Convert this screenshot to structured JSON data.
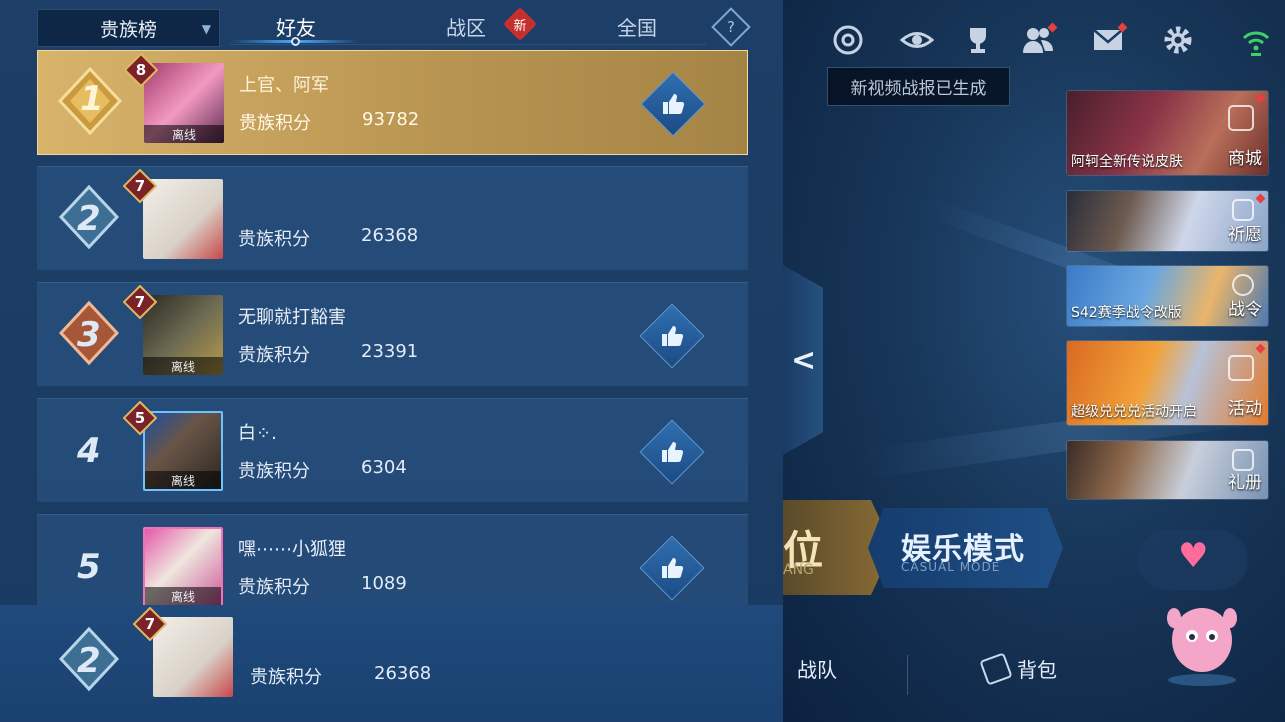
{
  "tabs": {
    "dropdown_label": "贵族榜",
    "friends": "好友",
    "zone": "战区",
    "zone_badge": "新",
    "national": "全国",
    "help": "?"
  },
  "score_label": "贵族积分",
  "offline_label": "离线",
  "rows": [
    {
      "rank": "1",
      "level": "8",
      "name": "上官、阿军",
      "score": "93782",
      "offline": true
    },
    {
      "rank": "2",
      "level": "7",
      "name": "",
      "score": "26368",
      "offline": false
    },
    {
      "rank": "3",
      "level": "7",
      "name": "无聊就打豁害",
      "score": "23391",
      "offline": true
    },
    {
      "rank": "4",
      "level": "5",
      "name": "白⁘.",
      "score": "6304",
      "offline": true
    },
    {
      "rank": "5",
      "level": "",
      "name": "嘿⋯⋯小狐狸",
      "score": "1089",
      "offline": true
    }
  ],
  "my_row": {
    "rank": "2",
    "level": "7",
    "score": "26368"
  },
  "background": {
    "tooltip": "新视频战报已生成",
    "promos": [
      {
        "caption": "阿轲全新传说皮肤",
        "side": "商城"
      },
      {
        "caption": "",
        "side": "祈愿"
      },
      {
        "caption": "S42赛季战令改版",
        "side": "战令"
      },
      {
        "caption": "超级兑兑兑活动开启",
        "side": "活动"
      },
      {
        "caption": "",
        "side": "礼册"
      }
    ],
    "mode_rank": "位",
    "mode_rank_sub": "ANG",
    "mode_casual": "娱乐模式",
    "mode_casual_sub": "CASUAL MODE",
    "nav_team": "战队",
    "nav_bag": "背包",
    "heart": "♥"
  },
  "colors": {
    "gold_row": "#c4a05c",
    "row_bg": "#2d588a",
    "like": "#2f6fb0",
    "new_badge": "#c5302c"
  }
}
